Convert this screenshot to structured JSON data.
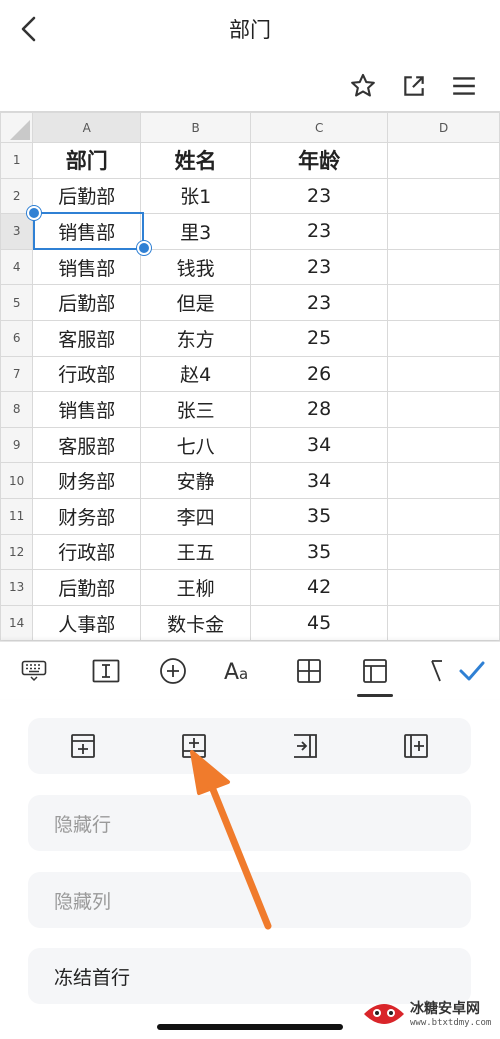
{
  "header": {
    "title": "部门"
  },
  "toolbar": {
    "icons": [
      "star-icon",
      "share-icon",
      "menu-icon"
    ]
  },
  "sheet": {
    "columns": [
      "A",
      "B",
      "C",
      "D"
    ],
    "selected_column": "A",
    "selected_row": "3",
    "rows": [
      {
        "num": "1",
        "a": "部门",
        "b": "姓名",
        "c": "年龄",
        "d": ""
      },
      {
        "num": "2",
        "a": "后勤部",
        "b": "张1",
        "c": "23",
        "d": ""
      },
      {
        "num": "3",
        "a": "销售部",
        "b": "里3",
        "c": "23",
        "d": ""
      },
      {
        "num": "4",
        "a": "销售部",
        "b": "钱我",
        "c": "23",
        "d": ""
      },
      {
        "num": "5",
        "a": "后勤部",
        "b": "但是",
        "c": "23",
        "d": ""
      },
      {
        "num": "6",
        "a": "客服部",
        "b": "东方",
        "c": "25",
        "d": ""
      },
      {
        "num": "7",
        "a": "行政部",
        "b": "赵4",
        "c": "26",
        "d": ""
      },
      {
        "num": "8",
        "a": "销售部",
        "b": "张三",
        "c": "28",
        "d": ""
      },
      {
        "num": "9",
        "a": "客服部",
        "b": "七八",
        "c": "34",
        "d": ""
      },
      {
        "num": "10",
        "a": "财务部",
        "b": "安静",
        "c": "34",
        "d": ""
      },
      {
        "num": "11",
        "a": "财务部",
        "b": "李四",
        "c": "35",
        "d": ""
      },
      {
        "num": "12",
        "a": "行政部",
        "b": "王五",
        "c": "35",
        "d": ""
      },
      {
        "num": "13",
        "a": "后勤部",
        "b": "王柳",
        "c": "42",
        "d": ""
      },
      {
        "num": "14",
        "a": "人事部",
        "b": "数卡金",
        "c": "45",
        "d": ""
      }
    ]
  },
  "editbar": {
    "icons": [
      "keyboard-icon",
      "text-cursor-icon",
      "insert-plus-icon",
      "font-format-icon",
      "border-grid-icon",
      "table-layout-icon",
      "formula-icon",
      "confirm-check-icon"
    ],
    "active": "table-layout-icon",
    "accent": "#2f80d4"
  },
  "panel": {
    "insert_icons": [
      "insert-row-above-icon",
      "insert-row-below-icon",
      "insert-column-left-icon",
      "insert-column-right-icon"
    ],
    "hide_rows": "隐藏行",
    "hide_columns": "隐藏列",
    "freeze_first_row": "冻结首行"
  },
  "annotation": {
    "arrow_color": "#f07b2c"
  },
  "watermark": {
    "name": "冰糖安卓网",
    "url": "www.btxtdmy.com"
  }
}
